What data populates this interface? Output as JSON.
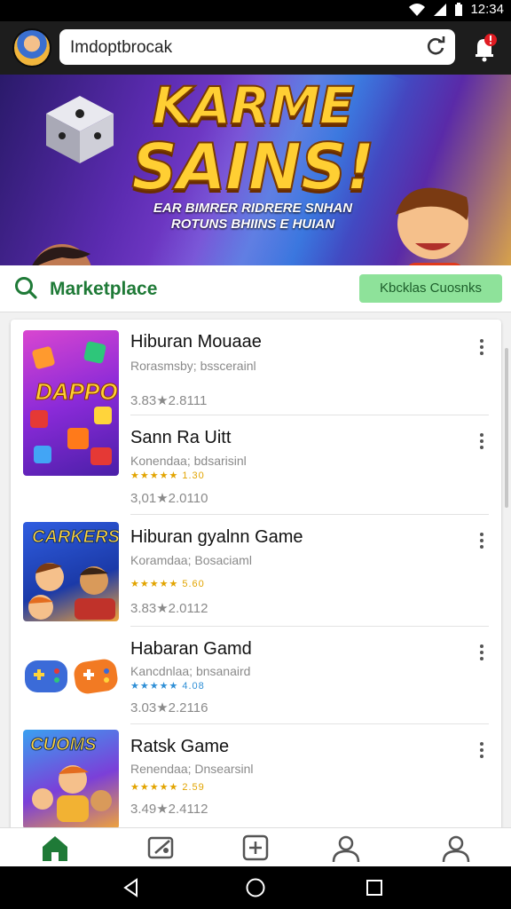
{
  "status_bar": {
    "time": "12:34"
  },
  "browser": {
    "url_text": "Imdoptbrocak"
  },
  "banner": {
    "title_line1": "KARME",
    "title_line2": "SAINS!",
    "subtitle_line1": "EAR BIMRER RIDRERE SNHAN",
    "subtitle_line2": "ROTUNS BHIINS E HUIAN"
  },
  "section": {
    "title": "Marketplace",
    "action_label": "Kbcklas Cuosnks"
  },
  "items": [
    {
      "title": "Hiburan Mouaae",
      "subtitle": "Rorasmsby; bsscerainl",
      "rating_text": "",
      "meta": "3.83★2.8111",
      "thumb_label": "DAPPO"
    },
    {
      "title": "Sann Ra Uitt",
      "subtitle": "Konendaa; bdsarisinl",
      "rating_text": "★★★★★ 1.30",
      "meta": "3,01★2.0110",
      "thumb_label": ""
    },
    {
      "title": "Hiburan gyalnn Game",
      "subtitle": "Koramdaa; Bosaciaml",
      "rating_text": "★★★★★ 5.60",
      "meta": "3.83★2.0112",
      "thumb_label": "CARKERS"
    },
    {
      "title": "Habaran Gamd",
      "subtitle": "Kancdnlaa; bnsanaird",
      "rating_text": "★★★★★ 4.08",
      "meta": "3.03★2.2116",
      "thumb_label": ""
    },
    {
      "title": "Ratsk Game",
      "subtitle": "Renendaa; Dnsearsinl",
      "rating_text": "★★★★★ 2.59",
      "meta": "3.49★2.4112",
      "thumb_label": "CUOMS"
    }
  ],
  "bottom_nav": [
    "home",
    "games",
    "apps",
    "profile",
    "account"
  ],
  "colors": {
    "accent_green": "#1f7a37",
    "chip_green": "#8ee29a",
    "star": "#e2a400",
    "top_bar": "#1d1d1d"
  }
}
